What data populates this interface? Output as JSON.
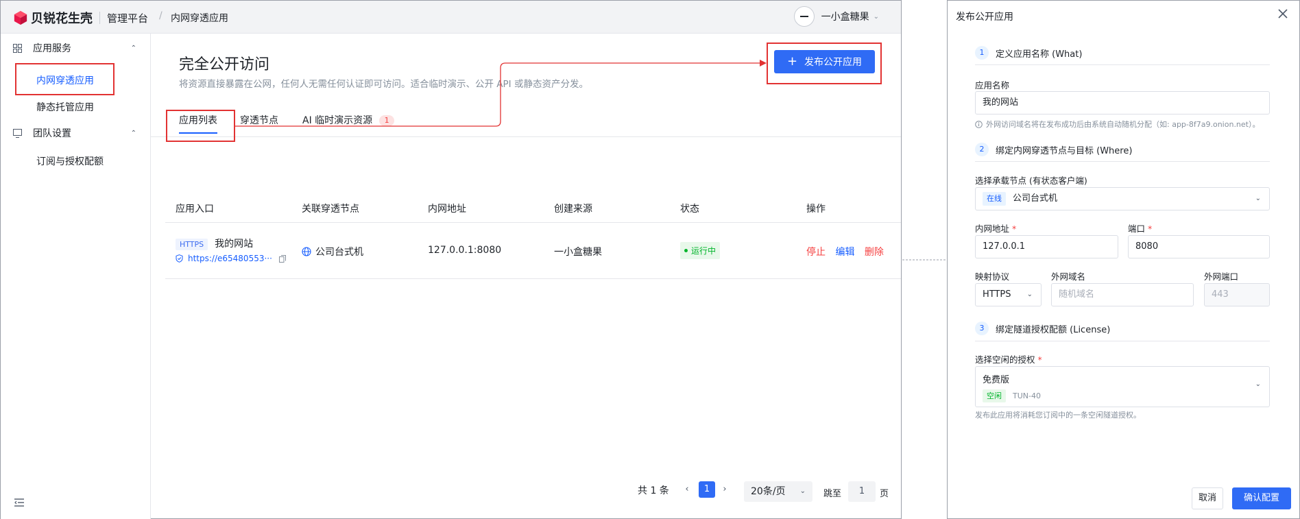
{
  "header": {
    "brand": "贝锐花生壳",
    "platform": "管理平台",
    "breadcrumb_sep": "/",
    "breadcrumb": "内网穿透应用",
    "user_name": "一小盒糖果"
  },
  "sidebar": {
    "group1": "应用服务",
    "group1_items": [
      "内网穿透应用",
      "静态托管应用"
    ],
    "group2": "团队设置",
    "group2_items": [
      "订阅与授权配额"
    ]
  },
  "main": {
    "title": "完全公开访问",
    "desc": "将资源直接暴露在公网，任何人无需任何认证即可访问。适合临时演示、公开 API 或静态资产分发。",
    "publish_button": "发布公开应用",
    "tabs": [
      "应用列表",
      "穿透节点",
      "AI 临时演示资源"
    ],
    "tab_badge": "1",
    "columns": [
      "应用入口",
      "关联穿透节点",
      "内网地址",
      "创建来源",
      "状态",
      "操作"
    ],
    "rows": [
      {
        "protocol": "HTTPS",
        "name": "我的网站",
        "url": "https://e65480553···",
        "node": "公司台式机",
        "address": "127.0.0.1:8080",
        "source": "一小盒糖果",
        "status": "运行中",
        "actions": [
          "停止",
          "编辑",
          "删除"
        ]
      }
    ],
    "pagination": {
      "total": "共 1 条",
      "current": "1",
      "page_size": "20条/页",
      "jump_label": "跳至",
      "jump_value": "1",
      "page_unit": "页"
    }
  },
  "dialog": {
    "title": "发布公开应用",
    "step1": {
      "num": "1",
      "title": "定义应用名称 (What)"
    },
    "name_label": "应用名称",
    "name_value": "我的网站",
    "name_hint": "外网访问域名将在发布成功后由系统自动随机分配（如: app-8f7a9.onion.net）。",
    "step2": {
      "num": "2",
      "title": "绑定内网穿透节点与目标 (Where)"
    },
    "node_label": "选择承载节点 (有状态客户端)",
    "node_status": "在线",
    "node_value": "公司台式机",
    "addr_label": "内网地址",
    "addr_value": "127.0.0.1",
    "port_label": "端口",
    "port_value": "8080",
    "proto_label": "映射协议",
    "proto_value": "HTTPS",
    "domain_label": "外网域名",
    "domain_placeholder": "随机域名",
    "ext_port_label": "外网端口",
    "ext_port_placeholder": "443",
    "step3": {
      "num": "3",
      "title": "绑定隧道授权配额 (License)"
    },
    "license_label": "选择空闲的授权",
    "license_name": "免费版",
    "license_status": "空闲",
    "license_id": "TUN-40",
    "license_hint": "发布此应用将消耗您订阅中的一条空闲隧道授权。",
    "cancel": "取消",
    "confirm": "确认配置"
  },
  "colors": {
    "primary": "#2f6bf5",
    "danger": "#f53f3f",
    "success": "#00b42a",
    "annotation": "#e23232"
  },
  "icons": [
    "cube-logo-icon",
    "apps-grid-icon",
    "monitor-icon",
    "chevron-up-icon",
    "chevron-down-icon",
    "globe-icon",
    "shield-icon",
    "copy-icon",
    "info-icon",
    "close-icon",
    "collapse-menu-icon"
  ]
}
